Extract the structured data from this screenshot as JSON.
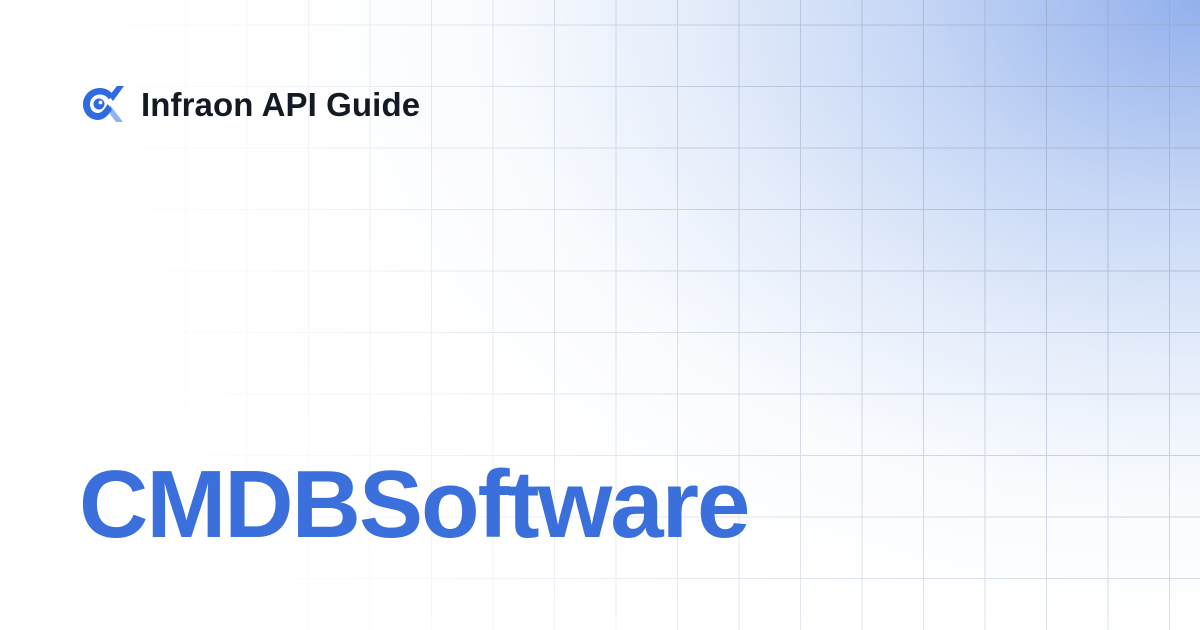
{
  "brand": {
    "name": "Infraon API Guide",
    "logo_icon": "infraon-logo-icon",
    "colors": {
      "logo_primary": "#2f6be0",
      "logo_secondary": "#8fb4f5"
    }
  },
  "page": {
    "title": "CMDBSoftware",
    "title_color": "#3a6fdc",
    "background_accent": "#8cacec"
  }
}
